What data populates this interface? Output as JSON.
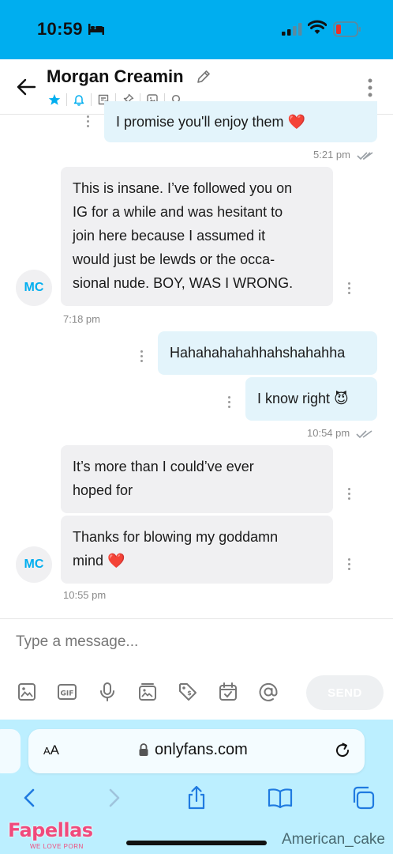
{
  "status_bar": {
    "time": "10:59",
    "icons": [
      "bed-icon",
      "cellular-signal-icon",
      "wifi-icon",
      "battery-low-icon"
    ]
  },
  "header": {
    "name": "Morgan Creamin",
    "icons": [
      "back-arrow-icon",
      "pencil-icon",
      "star-icon",
      "bell-icon",
      "note-icon",
      "pin-icon",
      "image-icon",
      "search-icon",
      "more-vertical-icon"
    ],
    "accent": "#00aeef"
  },
  "messages": [
    {
      "dir": "out",
      "text": "I promise you'll enjoy them ❤️"
    },
    {
      "dir": "meta-out",
      "text": "5:21 pm"
    },
    {
      "dir": "in",
      "lines": [
        "This is insane. I’ve followed you on",
        "IG for a while and was hesitant to",
        "join here because I assumed it",
        "would just be lewds or the occa-",
        "sional nude. BOY, WAS I WRONG."
      ]
    },
    {
      "dir": "avatar",
      "text": "MC"
    },
    {
      "dir": "meta-in",
      "text": "7:18 pm"
    },
    {
      "dir": "out",
      "text": "Hahahahahahhahshahahha"
    },
    {
      "dir": "out",
      "text": "I know right 😈"
    },
    {
      "dir": "meta-out",
      "text": "10:54 pm"
    },
    {
      "dir": "in",
      "lines": [
        "It’s more than I could’ve ever",
        "hoped for"
      ]
    },
    {
      "dir": "in",
      "lines": [
        "Thanks for blowing my goddamn",
        "mind ❤️"
      ]
    },
    {
      "dir": "avatar",
      "text": "MC"
    },
    {
      "dir": "meta-in",
      "text": "10:55 pm"
    }
  ],
  "composer": {
    "placeholder": "Type a message...",
    "send_label": "SEND",
    "tools": [
      "image-icon",
      "gif-icon",
      "microphone-icon",
      "media-vault-icon",
      "price-tag-icon",
      "calendar-icon",
      "at-mention-icon"
    ]
  },
  "browser": {
    "aa_label": "AA",
    "url": "onlyfans.com",
    "nav_icons": [
      "back-chevron-icon",
      "forward-chevron-icon",
      "share-icon",
      "bookmarks-icon",
      "tabs-icon"
    ],
    "bar_color": "#bcefff"
  },
  "watermark": {
    "logo": "Fapellas",
    "tagline": "WE LOVE PORN",
    "user": "American_cake"
  }
}
